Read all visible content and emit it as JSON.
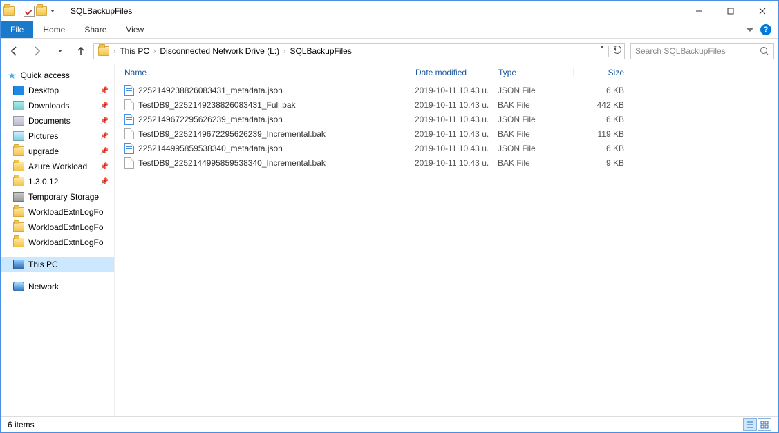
{
  "window": {
    "title": "SQLBackupFiles"
  },
  "ribbon": {
    "file": "File",
    "home": "Home",
    "share": "Share",
    "view": "View"
  },
  "breadcrumb": {
    "items": [
      "This PC",
      "Disconnected Network Drive (L:)",
      "SQLBackupFiles"
    ]
  },
  "search": {
    "placeholder": "Search SQLBackupFiles"
  },
  "sidebar": {
    "quick_access": "Quick access",
    "items": [
      {
        "icon": "desktop",
        "label": "Desktop",
        "pinned": true
      },
      {
        "icon": "down",
        "label": "Downloads",
        "pinned": true
      },
      {
        "icon": "doc",
        "label": "Documents",
        "pinned": true
      },
      {
        "icon": "pic",
        "label": "Pictures",
        "pinned": true
      },
      {
        "icon": "folder",
        "label": "upgrade",
        "pinned": true
      },
      {
        "icon": "folder",
        "label": "Azure Workload",
        "pinned": true
      },
      {
        "icon": "folder",
        "label": "1.3.0.12",
        "pinned": true
      },
      {
        "icon": "disk",
        "label": "Temporary Storage",
        "pinned": false
      },
      {
        "icon": "folder",
        "label": "WorkloadExtnLogFo",
        "pinned": false
      },
      {
        "icon": "folder",
        "label": "WorkloadExtnLogFo",
        "pinned": false
      },
      {
        "icon": "folder",
        "label": "WorkloadExtnLogFo",
        "pinned": false
      }
    ],
    "this_pc": "This PC",
    "network": "Network"
  },
  "columns": {
    "name": "Name",
    "date": "Date modified",
    "type": "Type",
    "size": "Size"
  },
  "files": [
    {
      "icon": "json",
      "name": "2252149238826083431_metadata.json",
      "date": "2019-10-11 10.43 u.",
      "type": "JSON File",
      "size": "6 KB"
    },
    {
      "icon": "bak",
      "name": "TestDB9_2252149238826083431_Full.bak",
      "date": "2019-10-11 10.43 u.",
      "type": "BAK File",
      "size": "442 KB"
    },
    {
      "icon": "json",
      "name": "2252149672295626239_metadata.json",
      "date": "2019-10-11 10.43 u.",
      "type": "JSON File",
      "size": "6 KB"
    },
    {
      "icon": "bak",
      "name": "TestDB9_2252149672295626239_Incremental.bak",
      "date": "2019-10-11 10.43 u.",
      "type": "BAK File",
      "size": "119 KB"
    },
    {
      "icon": "json",
      "name": "2252144995859538340_metadata.json",
      "date": "2019-10-11 10.43 u.",
      "type": "JSON File",
      "size": "6 KB"
    },
    {
      "icon": "bak",
      "name": "TestDB9_2252144995859538340_Incremental.bak",
      "date": "2019-10-11 10.43 u.",
      "type": "BAK File",
      "size": "9 KB"
    }
  ],
  "status": {
    "count": "6 items"
  }
}
